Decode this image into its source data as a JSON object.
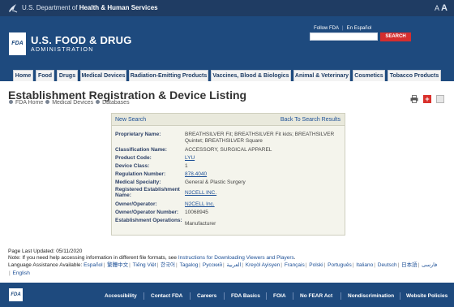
{
  "hhs": {
    "prefix": "U.S. Department of ",
    "name": "Health & Human Services",
    "text_size_small": "A",
    "text_size_large": "A"
  },
  "header": {
    "logo_text": "FDA",
    "agency_line1": "U.S. FOOD & DRUG",
    "agency_line2": "ADMINISTRATION",
    "follow_label": "Follow FDA",
    "espanol_label": "En Español",
    "search_value": "",
    "search_button": "SEARCH"
  },
  "nav": {
    "items": [
      "Home",
      "Food",
      "Drugs",
      "Medical Devices",
      "Radiation-Emitting Products",
      "Vaccines, Blood & Biologics",
      "Animal & Veterinary",
      "Cosmetics",
      "Tobacco Products"
    ]
  },
  "page": {
    "title": "Establishment Registration & Device Listing",
    "breadcrumbs": [
      "FDA Home",
      "Medical Devices",
      "Databases"
    ]
  },
  "panel": {
    "new_search": "New Search",
    "back_to_results": "Back To Search Results",
    "rows": [
      {
        "label": "Proprietary Name:",
        "value": "BREATHSILVER Fit; BREATHSILVER Fit kids; BREATHSILVER Quintet; BREATHSILVER Square"
      },
      {
        "label": "Classification Name:",
        "value": "ACCESSORY, SURGICAL APPAREL"
      },
      {
        "label": "Product Code:",
        "value": "LYU"
      },
      {
        "label": "Device Class:",
        "value": "1"
      },
      {
        "label": "Regulation Number:",
        "value": "878.4040"
      },
      {
        "label": "Medical Specialty:",
        "value": "General & Plastic Surgery"
      },
      {
        "label": "Registered Establishment Name:",
        "value": "N2CELL INC."
      },
      {
        "label": "Owner/Operator:",
        "value": "N2CELL Inc."
      },
      {
        "label": "Owner/Operator Number:",
        "value": "10068945"
      },
      {
        "label": "Establishment Operations:",
        "value": "Manufacturer"
      }
    ]
  },
  "footnotes": {
    "last_updated": "Page Last Updated: 05/11/2020",
    "note_prefix": "Note: If you need help accessing information in different file formats, see ",
    "note_link": "Instructions for Downloading Viewers and Players",
    "note_suffix": ".",
    "lang_label": "Language Assistance Available:",
    "languages": [
      "Español",
      "繁體中文",
      "Tiếng Việt",
      "한국어",
      "Tagalog",
      "Русский",
      "العربية",
      "Kreyòl Ayisyen",
      "Français",
      "Polski",
      "Português",
      "Italiano",
      "Deutsch",
      "日本語",
      "فارسی",
      "English"
    ]
  },
  "footer": {
    "logo_text": "FDA",
    "links": [
      "Accessibility",
      "Contact FDA",
      "Careers",
      "FDA Basics",
      "FOIA",
      "No FEAR Act",
      "Nondiscrimination",
      "Website Policies"
    ]
  },
  "colors": {
    "brand_blue": "#1e4a7e",
    "hhs_bar": "#1f3c63",
    "search_red": "#d42e2e",
    "link_blue": "#1c4f96"
  }
}
